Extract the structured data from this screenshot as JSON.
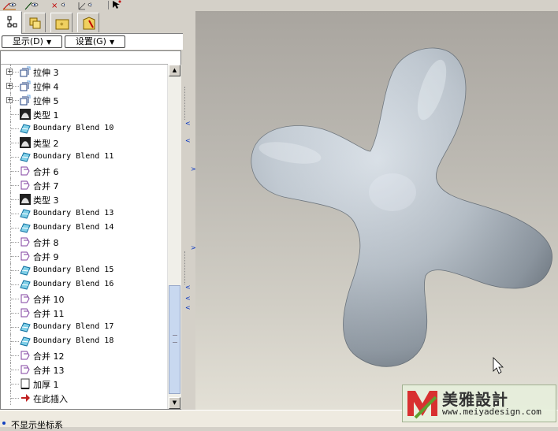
{
  "toolbar": {
    "icons": [
      "axis-display-icon",
      "plane-display-icon",
      "point-display-icon",
      "csys-display-icon",
      "select-cursor-icon"
    ]
  },
  "model_tree": {
    "tabs": [
      "model-tree-tab",
      "layers-tab",
      "folder-browser-tab",
      "favorites-tab"
    ],
    "show_button": "显示(D)",
    "settings_button": "设置(G)",
    "items": [
      {
        "label": "拉伸 3",
        "icon": "extrude",
        "expandable": true
      },
      {
        "label": "拉伸 4",
        "icon": "extrude",
        "expandable": true
      },
      {
        "label": "拉伸 5",
        "icon": "extrude",
        "expandable": true
      },
      {
        "label": "类型 1",
        "icon": "style",
        "expandable": false
      },
      {
        "label": "Boundary Blend 10",
        "icon": "blend",
        "expandable": false
      },
      {
        "label": "类型 2",
        "icon": "style",
        "expandable": false
      },
      {
        "label": "Boundary Blend 11",
        "icon": "blend",
        "expandable": false
      },
      {
        "label": "合并 6",
        "icon": "merge",
        "expandable": false
      },
      {
        "label": "合并 7",
        "icon": "merge",
        "expandable": false
      },
      {
        "label": "类型 3",
        "icon": "style",
        "expandable": false
      },
      {
        "label": "Boundary Blend 13",
        "icon": "blend",
        "expandable": false
      },
      {
        "label": "Boundary Blend 14",
        "icon": "blend",
        "expandable": false
      },
      {
        "label": "合并 8",
        "icon": "merge",
        "expandable": false
      },
      {
        "label": "合并 9",
        "icon": "merge",
        "expandable": false
      },
      {
        "label": "Boundary Blend 15",
        "icon": "blend",
        "expandable": false
      },
      {
        "label": "Boundary Blend 16",
        "icon": "blend",
        "expandable": false
      },
      {
        "label": "合并 10",
        "icon": "merge",
        "expandable": false
      },
      {
        "label": "合并 11",
        "icon": "merge",
        "expandable": false
      },
      {
        "label": "Boundary Blend 17",
        "icon": "blend",
        "expandable": false
      },
      {
        "label": "Boundary Blend 18",
        "icon": "blend",
        "expandable": false
      },
      {
        "label": "合并 12",
        "icon": "merge",
        "expandable": false
      },
      {
        "label": "合并 13",
        "icon": "merge",
        "expandable": false
      },
      {
        "label": "加厚 1",
        "icon": "thicken",
        "expandable": false
      },
      {
        "label": "在此插入",
        "icon": "insert",
        "expandable": false
      }
    ]
  },
  "status": {
    "text": "不显示坐标系"
  },
  "watermark": {
    "title": "美雅設計",
    "url": "www.meiyadesign.com"
  },
  "colors": {
    "accent": "#0030c0",
    "model_surface": "#b8c2cc",
    "viewport_top": "#a9a59f",
    "viewport_bottom": "#e3e0d6"
  }
}
